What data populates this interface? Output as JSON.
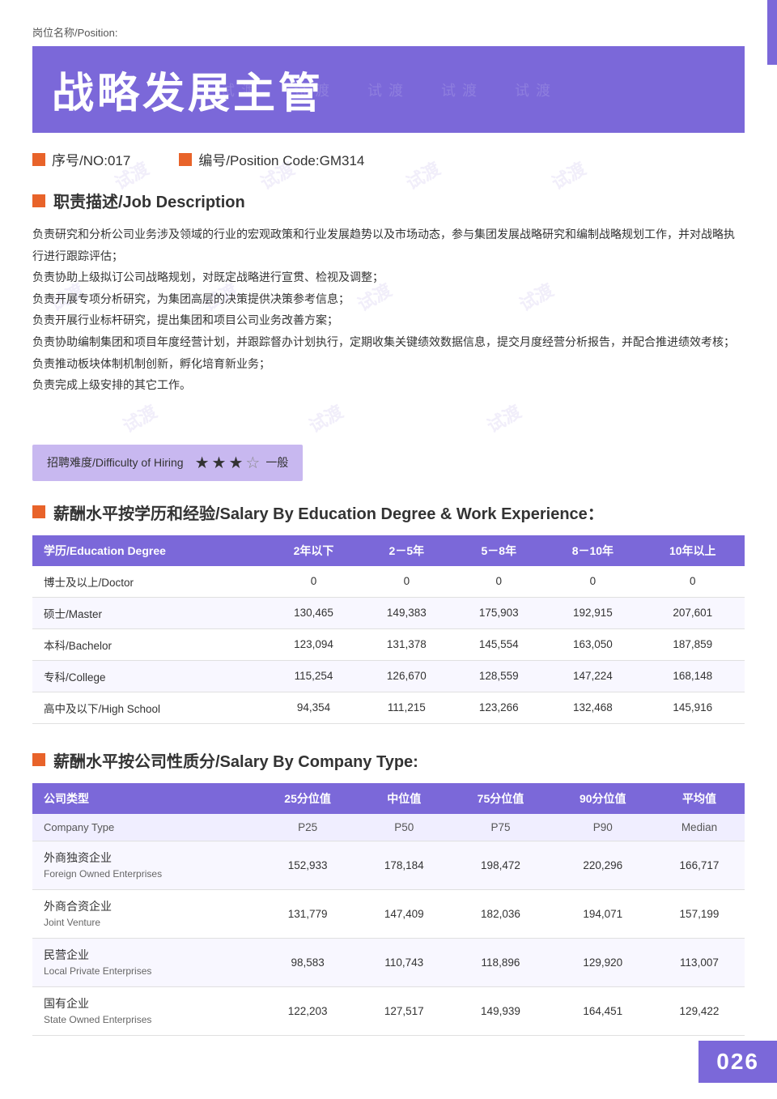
{
  "page": {
    "position_label": "岗位名称/Position:",
    "title_cn": "战略发展主管",
    "title_watermark": "试渡  试渡  试渡  试渡  试渡",
    "no_label": "序号/NO:017",
    "code_label": "编号/Position Code:GM314",
    "job_desc_header": "职责描述/Job Description",
    "job_desc_lines": [
      "负责研究和分析公司业务涉及领域的行业的宏观政策和行业发展趋势以及市场动态，参与集团发展战略研究和编制战略规划工作，并对战略执行进行跟踪评估；",
      "负责协助上级拟订公司战略规划，对既定战略进行宣贯、检视及调整；",
      "负责开展专项分析研究，为集团高层的决策提供决策参考信息；",
      "负责开展行业标杆研究，提出集团和项目公司业务改善方案；",
      "负责协助编制集团和项目年度经营计划，并跟踪督办计划执行，定期收集关键绩效数据信息，提交月度经营分析报告，并配合推进绩效考核；",
      "负责推动板块体制机制创新，孵化培育新业务；",
      "负责完成上级安排的其它工作。"
    ],
    "difficulty_label": "招聘难度/Difficulty of Hiring",
    "difficulty_stars": 3,
    "difficulty_max": 5,
    "difficulty_text": "一般",
    "salary_edu_header": "薪酬水平按学历和经验/Salary By Education Degree & Work Experience：",
    "salary_edu_columns": [
      "学历/Education Degree",
      "2年以下",
      "2－5年",
      "5－8年",
      "8－10年",
      "10年以上"
    ],
    "salary_edu_rows": [
      {
        "degree_cn": "博士及以上/Doctor",
        "values": [
          "0",
          "0",
          "0",
          "0",
          "0"
        ]
      },
      {
        "degree_cn": "硕士/Master",
        "values": [
          "130,465",
          "149,383",
          "175,903",
          "192,915",
          "207,601"
        ]
      },
      {
        "degree_cn": "本科/Bachelor",
        "values": [
          "123,094",
          "131,378",
          "145,554",
          "163,050",
          "187,859"
        ]
      },
      {
        "degree_cn": "专科/College",
        "values": [
          "115,254",
          "126,670",
          "128,559",
          "147,224",
          "168,148"
        ]
      },
      {
        "degree_cn": "高中及以下/High School",
        "values": [
          "94,354",
          "111,215",
          "123,266",
          "132,468",
          "145,916"
        ]
      }
    ],
    "salary_company_header": "薪酬水平按公司性质分/Salary By Company Type:",
    "salary_company_columns": [
      "公司类型",
      "25分位值",
      "中位值",
      "75分位值",
      "90分位值",
      "平均值"
    ],
    "salary_company_subheader": [
      "Company Type",
      "P25",
      "P50",
      "P75",
      "P90",
      "Median"
    ],
    "salary_company_rows": [
      {
        "type_cn": "外商独资企业",
        "type_en": "Foreign Owned Enterprises",
        "values": [
          "152,933",
          "178,184",
          "198,472",
          "220,296",
          "166,717"
        ]
      },
      {
        "type_cn": "外商合资企业",
        "type_en": "Joint Venture",
        "values": [
          "131,779",
          "147,409",
          "182,036",
          "194,071",
          "157,199"
        ]
      },
      {
        "type_cn": "民营企业",
        "type_en": "Local Private Enterprises",
        "values": [
          "98,583",
          "110,743",
          "118,896",
          "129,920",
          "113,007"
        ]
      },
      {
        "type_cn": "国有企业",
        "type_en": "State Owned Enterprises",
        "values": [
          "122,203",
          "127,517",
          "149,939",
          "164,451",
          "129,422"
        ]
      }
    ],
    "page_number": "026",
    "accent_color": "#7b68d9",
    "orange_color": "#e8632a"
  },
  "watermarks": [
    "试渡",
    "试渡",
    "试渡",
    "试渡",
    "试渡",
    "试渡",
    "试渡",
    "试渡",
    "试渡",
    "试渡",
    "试渡",
    "试渡"
  ]
}
